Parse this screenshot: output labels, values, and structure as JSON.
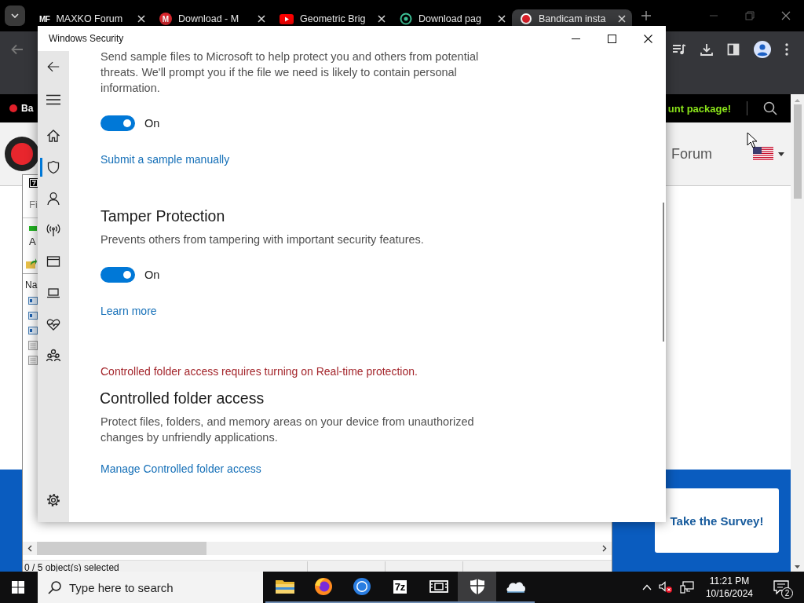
{
  "browser": {
    "tabs": [
      {
        "title": "MAXKO Forum",
        "kind": "mf",
        "icon_text": "MF",
        "selected": false
      },
      {
        "title": "Download - M",
        "kind": "mega",
        "icon_text": "M",
        "selected": false
      },
      {
        "title": "Geometric Brig",
        "kind": "video",
        "selected": false
      },
      {
        "title": "Download pag",
        "kind": "ring",
        "selected": false
      },
      {
        "title": "Bandicam insta",
        "kind": "record",
        "selected": true
      }
    ],
    "banner": {
      "left_text": "Ba",
      "right_text": "unt package!"
    },
    "site_nav": "Forum",
    "survey_button": "Take the Survey!"
  },
  "archive_window": {
    "filter_text": "Fi",
    "address_text": "A",
    "column_header": "Na",
    "status": "0 / 5 object(s) selected"
  },
  "security_window": {
    "title": "Windows Security",
    "nav": [
      {
        "kind": "home",
        "selected": false
      },
      {
        "kind": "shield",
        "selected": true
      },
      {
        "kind": "person",
        "selected": false
      },
      {
        "kind": "antenna",
        "selected": false
      },
      {
        "kind": "browser",
        "selected": false
      },
      {
        "kind": "laptop",
        "selected": false
      },
      {
        "kind": "heart",
        "selected": false
      },
      {
        "kind": "family",
        "selected": false
      }
    ],
    "content": [
      {
        "kind": "paragraph",
        "text": "Send sample files to Microsoft to help protect you and others from potential threats. We'll prompt you if the file we need is likely to contain personal information."
      },
      {
        "kind": "toggle",
        "on": true,
        "label": "On"
      },
      {
        "kind": "link",
        "text": "Submit a sample manually"
      },
      {
        "kind": "heading",
        "text": "Tamper Protection"
      },
      {
        "kind": "paragraph",
        "text": "Prevents others from tampering with important security features."
      },
      {
        "kind": "toggle",
        "on": true,
        "label": "On"
      },
      {
        "kind": "link",
        "text": "Learn more"
      },
      {
        "kind": "warning",
        "text": "Controlled folder access requires turning on Real-time protection."
      },
      {
        "kind": "heading",
        "text": "Controlled folder access"
      },
      {
        "kind": "paragraph",
        "text": "Protect files, folders, and memory areas on your device from unauthorized changes by unfriendly applications."
      },
      {
        "kind": "link",
        "text": "Manage Controlled folder access"
      }
    ]
  },
  "taskbar": {
    "search_placeholder": "Type here to search",
    "apps": [
      {
        "kind": "folder",
        "selected": false
      },
      {
        "kind": "firefox",
        "selected": false
      },
      {
        "kind": "chrome",
        "selected": false
      },
      {
        "kind": "archive",
        "icon_text": "7z",
        "selected": false
      },
      {
        "kind": "film",
        "selected": false
      },
      {
        "kind": "shield",
        "selected": true
      },
      {
        "kind": "cloud",
        "selected": false
      }
    ],
    "time": "11:21 PM",
    "date": "10/16/2024",
    "notifications": "2"
  }
}
